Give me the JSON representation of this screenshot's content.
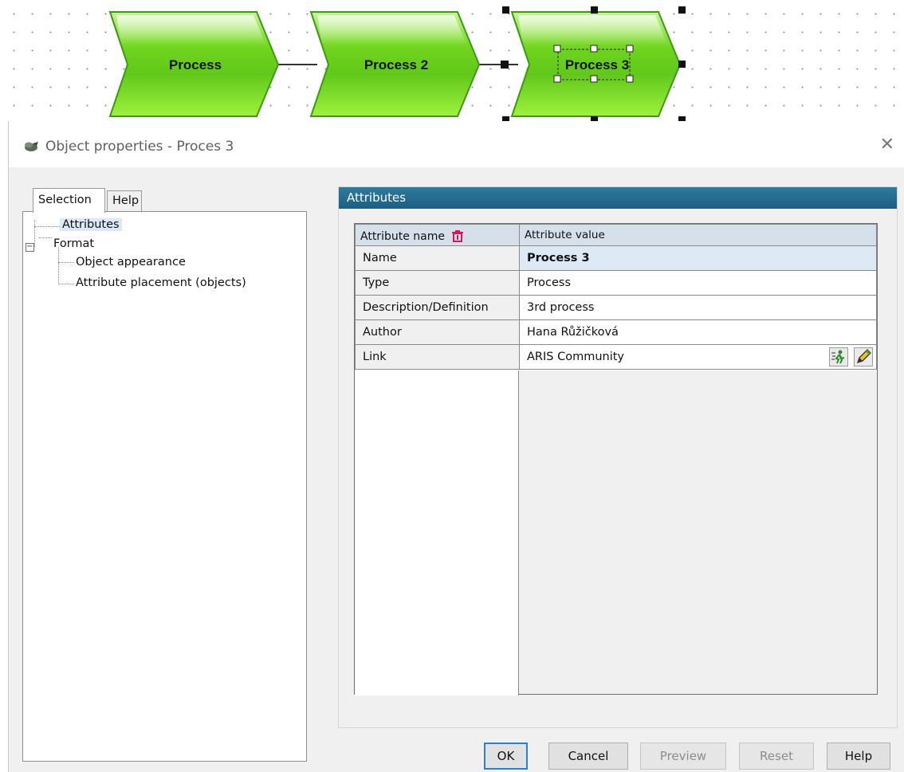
{
  "canvas": {
    "process_shapes": [
      {
        "label": "Process"
      },
      {
        "label": "Process 2"
      },
      {
        "label": "Process 3"
      }
    ]
  },
  "dialog": {
    "title": "Object properties - Proces 3",
    "close_glyph": "✕",
    "tabs": [
      "Selection",
      "Help"
    ],
    "tree": {
      "attributes": "Attributes",
      "format": "Format",
      "object_appearance": "Object appearance",
      "attribute_placement": "Attribute placement (objects)"
    },
    "attributes_header": "Attributes",
    "table": {
      "col_name": "Attribute name",
      "col_value": "Attribute value",
      "rows": [
        {
          "name": "Name",
          "value": "Process 3"
        },
        {
          "name": "Type",
          "value": "Process"
        },
        {
          "name": "Description/Definition",
          "value": "3rd process"
        },
        {
          "name": "Author",
          "value": "Hana Růžičková"
        },
        {
          "name": "Link",
          "value": "ARIS Community"
        }
      ]
    },
    "buttons": {
      "ok": "OK",
      "cancel": "Cancel",
      "preview": "Preview",
      "reset": "Reset",
      "help": "Help"
    }
  },
  "colors": {
    "process_fill": "#7ee020",
    "header_blue": "#1b5f82",
    "selection_blue": "#dce8f5",
    "delete_red": "#e0105a"
  }
}
